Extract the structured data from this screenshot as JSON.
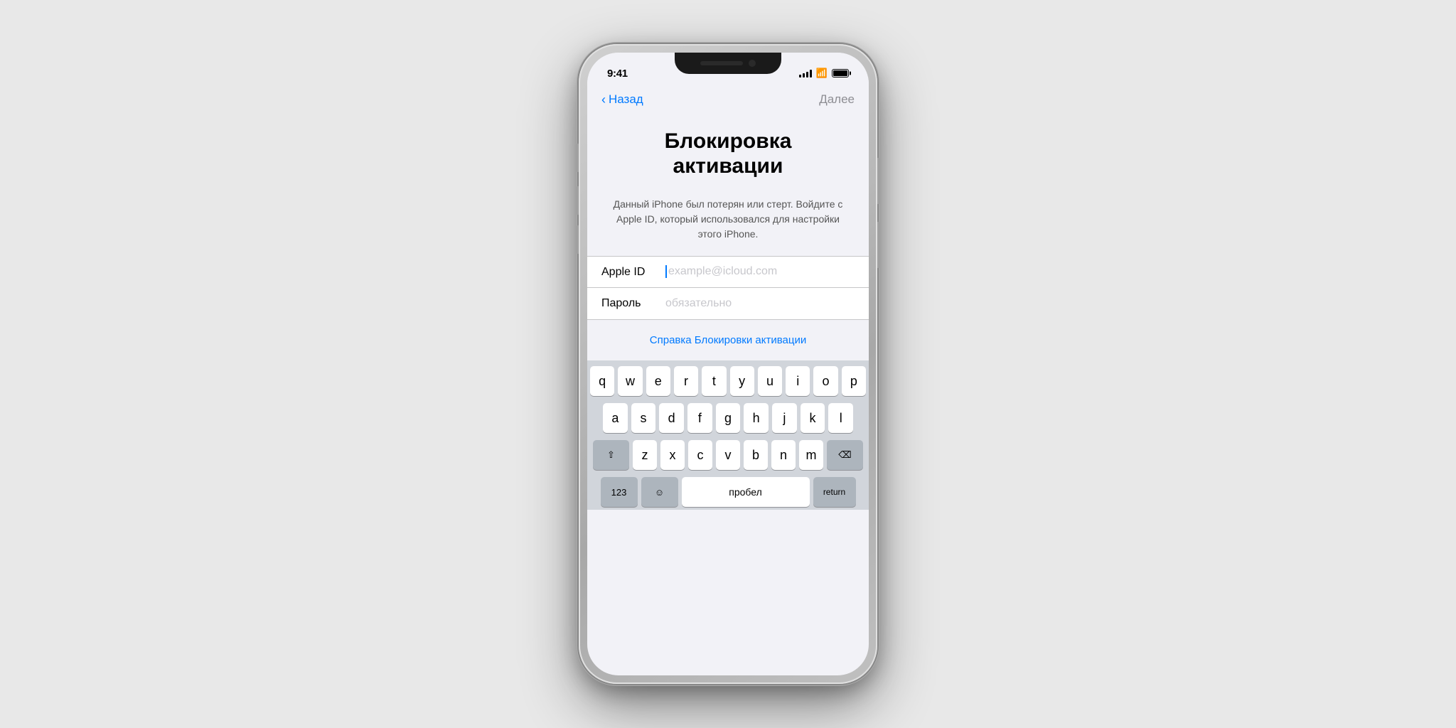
{
  "phone": {
    "status_bar": {
      "time": "9:41",
      "signal": "●●●●",
      "wifi": "wifi",
      "battery": "battery"
    },
    "nav": {
      "back_label": "Назад",
      "next_label": "Далее"
    },
    "title": "Блокировка активации",
    "description": "Данный iPhone был потерян или стерт. Войдите с Apple ID, который использовался для настройки этого iPhone.",
    "form": {
      "apple_id_label": "Apple ID",
      "apple_id_placeholder": "example@icloud.com",
      "apple_id_value": "",
      "password_label": "Пароль",
      "password_placeholder": "обязательно",
      "password_value": ""
    },
    "help_link": "Справка Блокировки активации",
    "keyboard": {
      "row1": [
        "q",
        "w",
        "e",
        "r",
        "t",
        "y",
        "u",
        "i",
        "o",
        "p"
      ],
      "row2": [
        "a",
        "s",
        "d",
        "f",
        "g",
        "h",
        "j",
        "k",
        "l"
      ],
      "row3_special_left": "⇧",
      "row3_chars": [
        "z",
        "x",
        "c",
        "v",
        "b",
        "n",
        "m"
      ],
      "row3_special_right": "⌫",
      "row4_left": "123",
      "row4_space": "пробел",
      "row4_right": "return"
    }
  }
}
